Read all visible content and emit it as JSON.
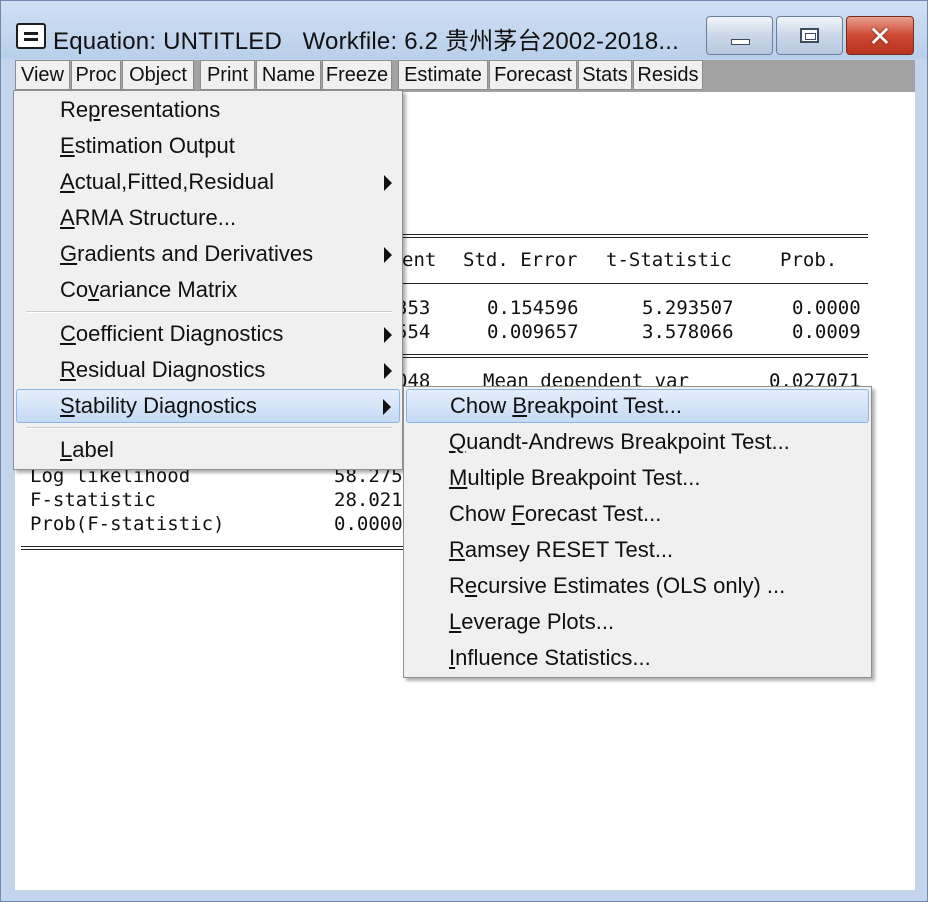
{
  "window": {
    "title": "Equation: UNTITLED   Workfile: 6.2 贵州茅台2002-2018..."
  },
  "toolbar": {
    "buttons": [
      "View",
      "Proc",
      "Object",
      "Print",
      "Name",
      "Freeze",
      "Estimate",
      "Forecast",
      "Stats",
      "Resids"
    ]
  },
  "table": {
    "headers": {
      "coef_fragment": "ent",
      "std_error": "Std. Error",
      "t_stat": "t-Statistic",
      "prob": "Prob."
    },
    "rows": [
      {
        "coef_fragment": "353",
        "std_error": "0.154596",
        "t_stat": "5.293507",
        "prob": "0.0000"
      },
      {
        "coef_fragment": "554",
        "std_error": "0.009657",
        "t_stat": "3.578066",
        "prob": "0.0009"
      }
    ],
    "stats_partial": {
      "left_fragment": "048",
      "label": "Mean dependent var",
      "value": "0.027071"
    },
    "stats": [
      {
        "label": "Log likelihood",
        "value": "58.275"
      },
      {
        "label": "F-statistic",
        "value": "28.021"
      },
      {
        "label": "Prob(F-statistic)",
        "value": "0.0000"
      }
    ]
  },
  "view_menu": {
    "items": [
      {
        "pre": "Re",
        "u": "p",
        "post": "resentations",
        "submenu": false
      },
      {
        "pre": "",
        "u": "E",
        "post": "stimation Output",
        "submenu": false
      },
      {
        "pre": "",
        "u": "A",
        "post": "ctual,Fitted,Residual",
        "submenu": true
      },
      {
        "pre": "",
        "u": "A",
        "post": "RMA Structure...",
        "submenu": false
      },
      {
        "pre": "",
        "u": "G",
        "post": "radients and Derivatives",
        "submenu": true
      },
      {
        "pre": "Co",
        "u": "v",
        "post": "ariance Matrix",
        "submenu": false
      },
      {
        "pre": "",
        "u": "C",
        "post": "oefficient Diagnostics",
        "submenu": true
      },
      {
        "pre": "",
        "u": "R",
        "post": "esidual Diagnostics",
        "submenu": true
      },
      {
        "pre": "",
        "u": "S",
        "post": "tability Diagnostics",
        "submenu": true
      },
      {
        "pre": "",
        "u": "L",
        "post": "abel",
        "submenu": false
      }
    ]
  },
  "stability_submenu": {
    "items": [
      {
        "pre": "Chow ",
        "u": "B",
        "post": "reakpoint Test..."
      },
      {
        "pre": "",
        "u": "Q",
        "post": "uandt-Andrews Breakpoint Test..."
      },
      {
        "pre": "",
        "u": "M",
        "post": "ultiple Breakpoint Test..."
      },
      {
        "pre": "Chow ",
        "u": "F",
        "post": "orecast Test..."
      },
      {
        "pre": "",
        "u": "R",
        "post": "amsey RESET Test..."
      },
      {
        "pre": "R",
        "u": "e",
        "post": "cursive Estimates (OLS only) ..."
      },
      {
        "pre": "",
        "u": "L",
        "post": "everage Plots..."
      },
      {
        "pre": "",
        "u": "I",
        "post": "nfluence Statistics..."
      }
    ]
  },
  "colors": {
    "titlebar": "#c3d5ec",
    "toolbar_bg": "#a2a2a2",
    "menu_bg": "#f0f0f0",
    "highlight": "#c5daf5",
    "close_button": "#cd4a33"
  }
}
